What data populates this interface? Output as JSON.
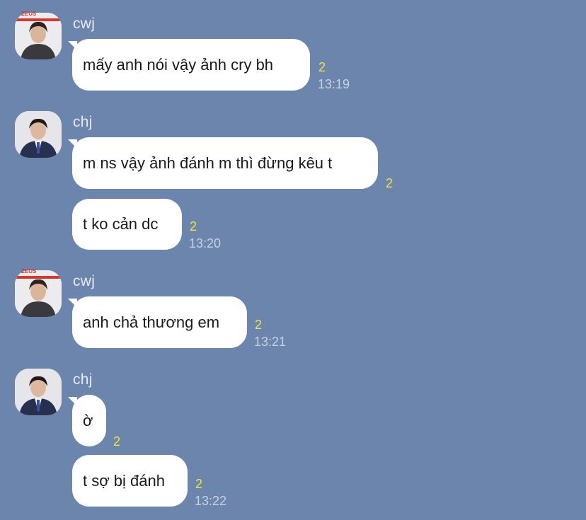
{
  "theme": {
    "background": "#6b85ad",
    "bubble": "#ffffff",
    "count_color": "#f3e33a",
    "time_color": "#c8d1e0"
  },
  "avatars": {
    "cwj_badge": "ZEUS"
  },
  "groups": [
    {
      "sender": "cwj",
      "messages": [
        {
          "text": "mấy anh nói vậy ảnh cry bh",
          "count": "2",
          "time": "13:19"
        }
      ]
    },
    {
      "sender": "chj",
      "messages": [
        {
          "text": "m ns vậy ảnh đánh m thì đừng kêu t",
          "count": "2"
        },
        {
          "text": "t ko cản dc",
          "count": "2",
          "time": "13:20"
        }
      ]
    },
    {
      "sender": "cwj",
      "messages": [
        {
          "text": "anh chả thương em",
          "count": "2",
          "time": "13:21"
        }
      ]
    },
    {
      "sender": "chj",
      "messages": [
        {
          "text": "ờ",
          "count": "2"
        },
        {
          "text": "t sợ bị đánh",
          "count": "2",
          "time": "13:22"
        }
      ]
    }
  ]
}
